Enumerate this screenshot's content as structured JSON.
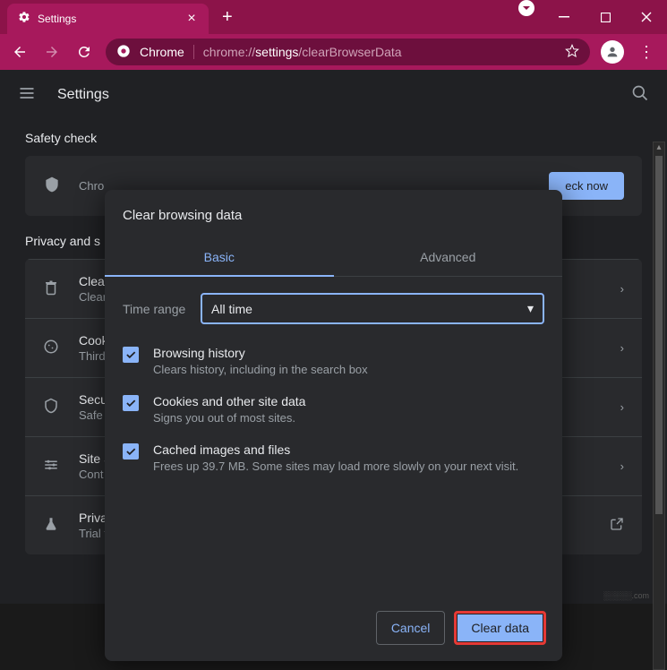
{
  "titlebar": {
    "tab_title": "Settings",
    "close": "×",
    "new_tab": "+"
  },
  "addrbar": {
    "chrome_label": "Chrome",
    "url_prefix": "chrome://",
    "url_bold": "settings",
    "url_suffix": "/clearBrowserData"
  },
  "page": {
    "title": "Settings"
  },
  "safety": {
    "heading": "Safety check",
    "line": "Chro",
    "button": "eck now"
  },
  "privacy": {
    "heading": "Privacy and s",
    "rows": [
      {
        "t": "Clear",
        "s": "Clear"
      },
      {
        "t": "Cook",
        "s": "Third"
      },
      {
        "t": "Secu",
        "s": "Safe"
      },
      {
        "t": "Site S",
        "s": "Cont"
      },
      {
        "t": "Privacy ░░░░░░",
        "s": "Trial features are on"
      }
    ]
  },
  "modal": {
    "title": "Clear browsing data",
    "tabs": {
      "basic": "Basic",
      "advanced": "Advanced"
    },
    "time_range_label": "Time range",
    "time_range_value": "All time",
    "options": [
      {
        "t": "Browsing history",
        "s": "Clears history, including in the search box"
      },
      {
        "t": "Cookies and other site data",
        "s": "Signs you out of most sites."
      },
      {
        "t": "Cached images and files",
        "s": "Frees up 39.7 MB. Some sites may load more slowly on your next visit."
      }
    ],
    "cancel": "Cancel",
    "clear": "Clear data"
  },
  "watermark": "░░░░░.com"
}
